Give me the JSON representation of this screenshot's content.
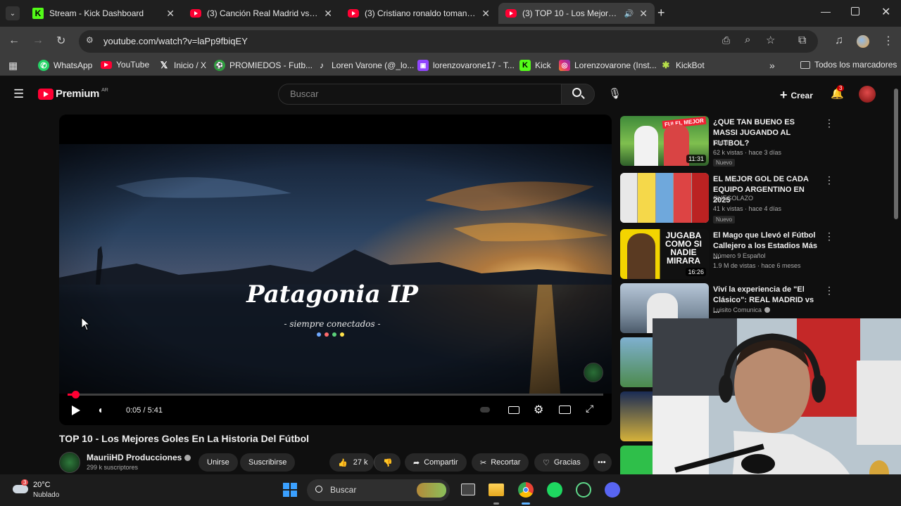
{
  "tabs": [
    {
      "title": "Stream - Kick Dashboard",
      "favicon": "kick-icon",
      "active": false
    },
    {
      "title": "(3) Canción Real Madrid vs Barc",
      "favicon": "youtube-icon",
      "active": false
    },
    {
      "title": "(3) Cristiano ronaldo tomando",
      "favicon": "youtube-icon",
      "active": false
    },
    {
      "title": "(3) TOP 10 - Los Mejores Go",
      "favicon": "youtube-icon",
      "active": true
    }
  ],
  "address": {
    "url": "youtube.com/watch?v=laPp9fbiqEY"
  },
  "bookmarks": [
    {
      "label": "WhatsApp"
    },
    {
      "label": "YouTube"
    },
    {
      "label": "Inicio / X"
    },
    {
      "label": "PROMIEDOS - Futb..."
    },
    {
      "label": "Loren Varone (@_lo..."
    },
    {
      "label": "lorenzovarone17 - T..."
    },
    {
      "label": "Kick"
    },
    {
      "label": "Lorenzovarone (Inst..."
    },
    {
      "label": "KickBot"
    }
  ],
  "bookmarks_all": "Todos los marcadores",
  "youtube": {
    "logo_text": "Premium",
    "region": "AR",
    "search_placeholder": "Buscar",
    "create_label": "Crear",
    "notifications_count": "3"
  },
  "player": {
    "overlay_title": "Patagonia IP",
    "overlay_subtitle": "- siempre conectados -",
    "time": "0:05 / 5:41",
    "progress": 0.015
  },
  "video": {
    "title": "TOP 10 - Los Mejores Goles En La Historia Del Fútbol",
    "channel": "MauriiHD Producciones",
    "subscribers": "299 k suscriptores",
    "join_label": "Unirse",
    "subscribe_label": "Suscribirse",
    "likes": "27 k",
    "share_label": "Compartir",
    "clip_label": "Recortar",
    "thanks_label": "Gracias"
  },
  "recommendations": [
    {
      "title": "¿QUE TAN BUENO ES MASSI JUGANDO AL FUTBOL?",
      "channel": "Tonali",
      "meta": "62 k vistas · hace 3 días",
      "badge": "Nuevo",
      "duration": "11:31",
      "thumb_text": "FUI EL MEJOR"
    },
    {
      "title": "EL MEJOR GOL DE CADA EQUIPO ARGENTINO EN 2025",
      "channel": "QUEGOLAZO",
      "meta": "41 k vistas · hace 4 días",
      "badge": "Nuevo",
      "duration": "",
      "thumb_text": ""
    },
    {
      "title": "El Mago que Llevó el Fútbol Callejero a los Estadios Más ...",
      "channel": "Número 9 Español",
      "meta": "1.9 M de vistas · hace 6 meses",
      "badge": "",
      "duration": "16:26",
      "thumb_text": "JUGABA COMO SI NADIE MIRARA"
    },
    {
      "title": "Viví la experiencia de \"El Clásico\": REAL MADRID vs ...",
      "channel": "Luisito Comunica",
      "meta": "",
      "badge": "",
      "duration": "",
      "thumb_text": ""
    }
  ],
  "taskbar": {
    "weather_temp": "20°C",
    "weather_desc": "Nublado",
    "weather_badge": "3",
    "search_label": "Buscar"
  },
  "colors": {
    "youtube_red": "#ff0033",
    "kick_green": "#53fc18",
    "bg": "#0f0f0f"
  }
}
